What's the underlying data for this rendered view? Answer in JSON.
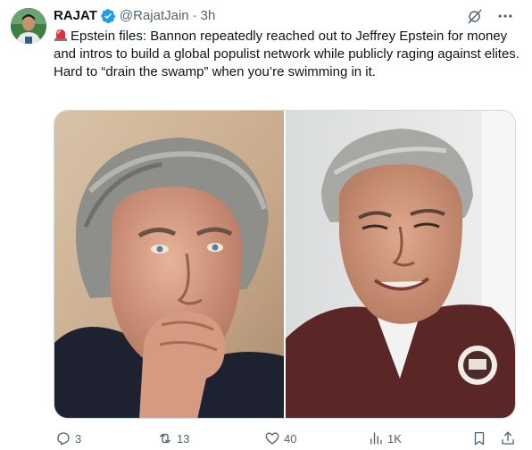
{
  "author": {
    "name": "RAJAT",
    "handle": "@RajatJain",
    "separator": "·",
    "time": "3h"
  },
  "tweet": {
    "line1": "Epstein files: Bannon repeatedly reached out to Jeffrey Epstein for money and intros to build a global populist network while publicly raging against elites.",
    "line2": "Hard to “drain the swamp” when you’re swimming in it."
  },
  "stats": {
    "replies": "3",
    "reposts": "13",
    "likes": "40",
    "views": "1K"
  },
  "icons": {
    "verified": "verified-badge-icon",
    "grok": "grok-icon",
    "more": "more-icon",
    "siren": "rotating-light-emoji",
    "reply": "reply-icon",
    "repost": "repost-icon",
    "like": "heart-icon",
    "views": "views-icon",
    "bookmark": "bookmark-icon",
    "share": "share-icon"
  },
  "colors": {
    "text": "#0f1419",
    "secondary": "#536471",
    "verified": "#1d9bf0",
    "border": "#cfd9de"
  }
}
